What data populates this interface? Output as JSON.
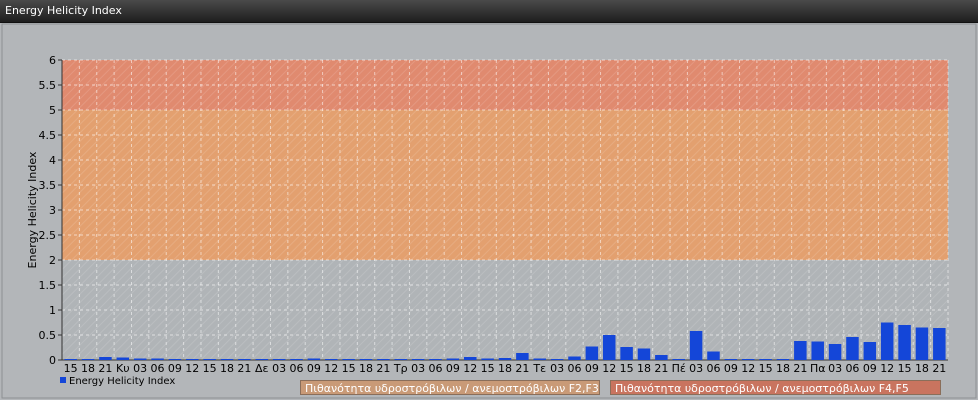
{
  "window": {
    "title": "Energy Helicity Index"
  },
  "colors": {
    "bar": "#1446d8",
    "zone_high": "#e08a6f",
    "zone_mid": "#e3a06f",
    "zone_low": "#b0b4b7"
  },
  "legend": {
    "series_label": "Energy Helicity Index",
    "zone_f2f3": "Πιθανότητα υδροστρόβιλων / ανεμοστρόβιλων F2,F3",
    "zone_f4f5": "Πιθανότητα υδροστρόβιλων / ανεμοστρόβιλων F4,F5"
  },
  "chart_data": {
    "type": "bar",
    "ylabel": "Energy Helicity Index",
    "ylim": [
      0,
      6
    ],
    "yticks": [
      "0",
      "0.5",
      "1",
      "1.5",
      "2",
      "2.5",
      "3",
      "3.5",
      "4",
      "4.5",
      "5",
      "5.5",
      "6"
    ],
    "bands": [
      {
        "from": 0,
        "to": 2,
        "color": "#b0b4b7"
      },
      {
        "from": 2,
        "to": 5,
        "color": "#e3a06f"
      },
      {
        "from": 5,
        "to": 6,
        "color": "#e08a6f"
      }
    ],
    "categories": [
      "15",
      "18",
      "21",
      "Κυ",
      "03",
      "06",
      "09",
      "12",
      "15",
      "18",
      "21",
      "Δε",
      "03",
      "06",
      "09",
      "12",
      "15",
      "18",
      "21",
      "Τρ",
      "03",
      "06",
      "09",
      "12",
      "15",
      "18",
      "21",
      "Τε",
      "03",
      "06",
      "09",
      "12",
      "15",
      "18",
      "21",
      "Πέ",
      "03",
      "06",
      "09",
      "12",
      "15",
      "18",
      "21",
      "Πα",
      "03",
      "06",
      "09",
      "12",
      "15",
      "18",
      "21"
    ],
    "values": [
      0.02,
      0.02,
      0.06,
      0.05,
      0.03,
      0.03,
      0.02,
      0.02,
      0.02,
      0.02,
      0.02,
      0.02,
      0.02,
      0.02,
      0.03,
      0.02,
      0.02,
      0.02,
      0.02,
      0.02,
      0.02,
      0.02,
      0.03,
      0.06,
      0.03,
      0.04,
      0.14,
      0.03,
      0.02,
      0.07,
      0.27,
      0.5,
      0.26,
      0.23,
      0.1,
      0.02,
      0.58,
      0.17,
      0.02,
      0.02,
      0.02,
      0.02,
      0.38,
      0.37,
      0.32,
      0.46,
      0.36,
      0.75,
      0.7,
      0.65,
      0.64
    ]
  }
}
